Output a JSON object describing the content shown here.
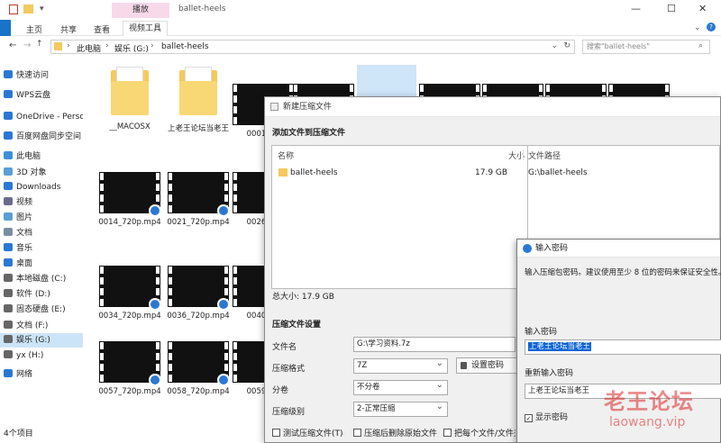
{
  "window": {
    "title": "ballet-heels",
    "context_tab": "播放",
    "min": "—",
    "max": "☐",
    "close": "✕"
  },
  "ribbon": {
    "tabs": [
      "主页",
      "共享",
      "查看",
      "视频工具"
    ]
  },
  "address": {
    "segments": [
      "此电脑",
      "娱乐 (G:)",
      "ballet-heels"
    ],
    "search_placeholder": "搜索\"ballet-heels\""
  },
  "sidebar": {
    "items": [
      {
        "label": "快速访问",
        "icon": "star-icon",
        "color": "#2a78d4"
      },
      {
        "label": "WPS云盘",
        "icon": "cloud-icon",
        "color": "#2a78d4"
      },
      {
        "label": "OneDrive - Persona",
        "icon": "onedrive-icon",
        "color": "#2a78d4"
      },
      {
        "label": "百度网盘同步空间",
        "icon": "baidu-icon",
        "color": "#2a78d4"
      },
      {
        "label": "此电脑",
        "icon": "computer-icon",
        "color": "#3d8fd9"
      },
      {
        "label": "3D 对象",
        "icon": "cube-icon",
        "color": "#5a9fd6"
      },
      {
        "label": "Downloads",
        "icon": "download-icon",
        "color": "#2a78d4"
      },
      {
        "label": "视频",
        "icon": "video-icon",
        "color": "#6b6b8c"
      },
      {
        "label": "图片",
        "icon": "picture-icon",
        "color": "#5a9fd6"
      },
      {
        "label": "文档",
        "icon": "document-icon",
        "color": "#7a8da0"
      },
      {
        "label": "音乐",
        "icon": "music-icon",
        "color": "#2a78d4"
      },
      {
        "label": "桌面",
        "icon": "desktop-icon",
        "color": "#2a78d4"
      },
      {
        "label": "本地磁盘 (C:)",
        "icon": "drive-icon",
        "color": "#666"
      },
      {
        "label": "软件 (D:)",
        "icon": "drive-icon",
        "color": "#666"
      },
      {
        "label": "固态硬盘 (E:)",
        "icon": "drive-icon",
        "color": "#666"
      },
      {
        "label": "文档 (F:)",
        "icon": "drive-icon",
        "color": "#666"
      },
      {
        "label": "娱乐 (G:)",
        "icon": "drive-icon",
        "color": "#666"
      },
      {
        "label": "yx (H:)",
        "icon": "drive-icon",
        "color": "#666"
      },
      {
        "label": "网络",
        "icon": "network-icon",
        "color": "#2a78d4"
      }
    ]
  },
  "files": [
    {
      "name": "__MACOSX",
      "kind": "folder"
    },
    {
      "name": "上老王论坛当老王",
      "kind": "folder"
    },
    {
      "name": "0001_72",
      "kind": "video"
    },
    {
      "name": "0014_720p.mp4",
      "kind": "video"
    },
    {
      "name": "0021_720p.mp4",
      "kind": "video"
    },
    {
      "name": "0026_72",
      "kind": "video"
    },
    {
      "name": "0034_720p.mp4",
      "kind": "video"
    },
    {
      "name": "0036_720p.mp4",
      "kind": "video"
    },
    {
      "name": "0040_72",
      "kind": "video"
    },
    {
      "name": "0057_720p.mp4",
      "kind": "video"
    },
    {
      "name": "0058_720p.mp4",
      "kind": "video"
    },
    {
      "name": "0059_72",
      "kind": "video"
    }
  ],
  "status": {
    "count": "4个项目"
  },
  "dialog": {
    "title": "新建压缩文件",
    "section_add": "添加文件到压缩文件",
    "col_name": "名称",
    "col_size": "大小",
    "col_path": "文件路径",
    "entry": {
      "name": "ballet-heels",
      "size": "17.9 GB",
      "path": "G:\\ballet-heels"
    },
    "total": "总大小: 17.9 GB",
    "section_settings": "压缩文件设置",
    "filename_label": "文件名",
    "filename_value": "G:\\学习资料.7z",
    "format_label": "压缩格式",
    "format_value": "7Z",
    "split_label": "分卷",
    "split_value": "不分卷",
    "level_label": "压缩级别",
    "level_value": "2-正常压缩",
    "password_button": "设置密码",
    "opt_test": "测试压缩文件(T)",
    "opt_delete": "压缩后删除原始文件",
    "opt_each": "把每个文件/文件夹"
  },
  "password_dialog": {
    "title": "输入密码",
    "hint": "输入压缩包密码。建议使用至少 8 位的密码来保证安全性。",
    "enter_label": "输入密码",
    "enter_value": "上老王论坛当老王",
    "reenter_label": "重新输入密码",
    "reenter_value": "上老王论坛当老王",
    "show_label": "显示密码"
  },
  "watermark": {
    "text": "老王论坛",
    "url": "laowang.vip"
  }
}
